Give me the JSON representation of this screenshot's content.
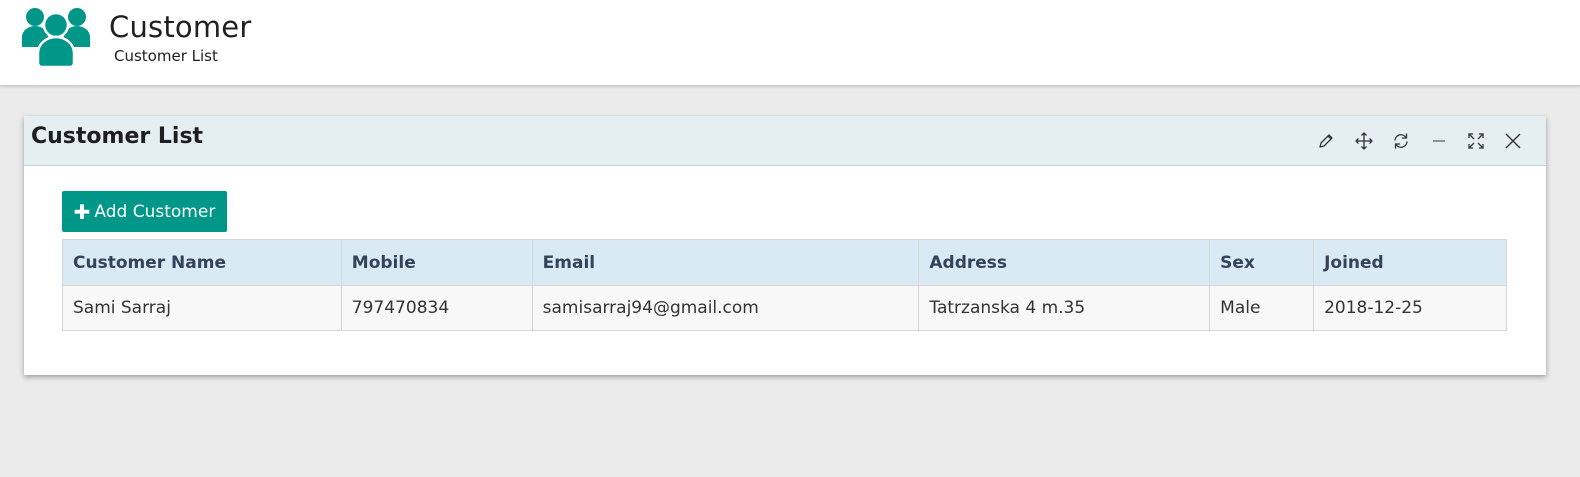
{
  "header": {
    "title": "Customer",
    "subtitle": "Customer List",
    "icon": "users-icon",
    "icon_color": "#009688"
  },
  "panel": {
    "title": "Customer List",
    "toolbar": [
      {
        "icon": "edit-icon"
      },
      {
        "icon": "move-icon"
      },
      {
        "icon": "refresh-icon"
      },
      {
        "icon": "minimize-icon"
      },
      {
        "icon": "fullscreen-icon"
      },
      {
        "icon": "close-icon"
      }
    ],
    "add_button": {
      "label": "Add Customer",
      "icon": "plus-icon",
      "color": "#009688"
    }
  },
  "table": {
    "columns": [
      "Customer Name",
      "Mobile",
      "Email",
      "Address",
      "Sex",
      "Joined"
    ],
    "rows": [
      [
        "Sami Sarraj",
        "797470834",
        "samisarraj94@gmail.com",
        "Tatrzanska 4 m.35",
        "Male",
        "2018-12-25"
      ]
    ]
  }
}
